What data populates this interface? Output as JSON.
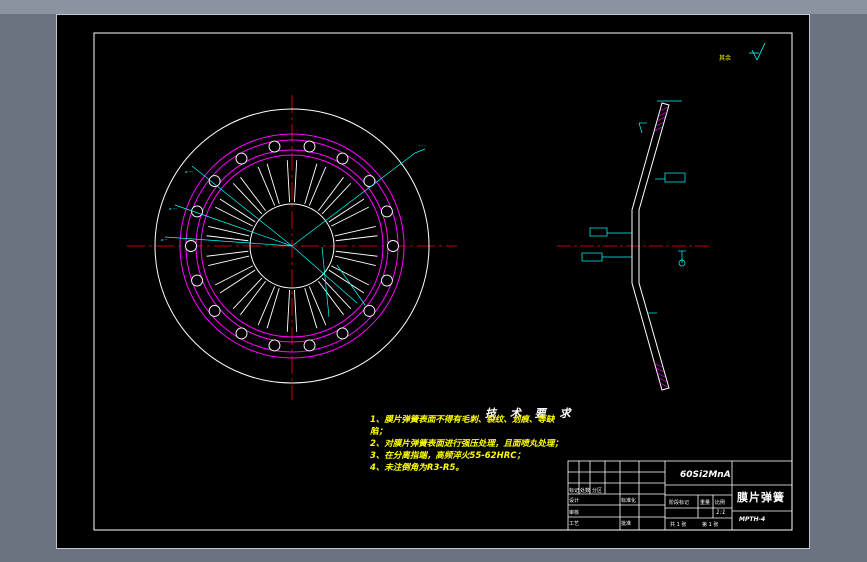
{
  "tech_requirements": {
    "title": "技 术 要 求",
    "lines": [
      "1、膜片弹簧表面不得有毛刺、裂纹、划痕、等缺",
      "陷；",
      "2、对膜片弹簧表面进行强压处理，且面喷丸处理；",
      "3、在分离指端，高频淬火55-62HRC；",
      "4、未注倒角为R3-R5。"
    ]
  },
  "surface_mark": "其余",
  "title_block": {
    "material": "60Si2MnA",
    "part_name": "膜片弹簧",
    "drawing_no": "MPTH-4",
    "row_labels": [
      "标记",
      "处数",
      "分区",
      "设计",
      "审核",
      "工艺"
    ],
    "standardization": "标准化",
    "approval": "批准",
    "stage_mark_label": "阶段标记",
    "weight_label": "重量",
    "scale_label": "比例",
    "scale": "1:1",
    "sheets_total": "共 1 张",
    "sheet_no": "第 1 张"
  },
  "colors": {
    "background": "#000000",
    "outline": "#ffffff",
    "dimension": "#00ffff",
    "hatch_circle": "#ff00ff",
    "centerline": "#ff0000",
    "text": "#ffff00"
  }
}
